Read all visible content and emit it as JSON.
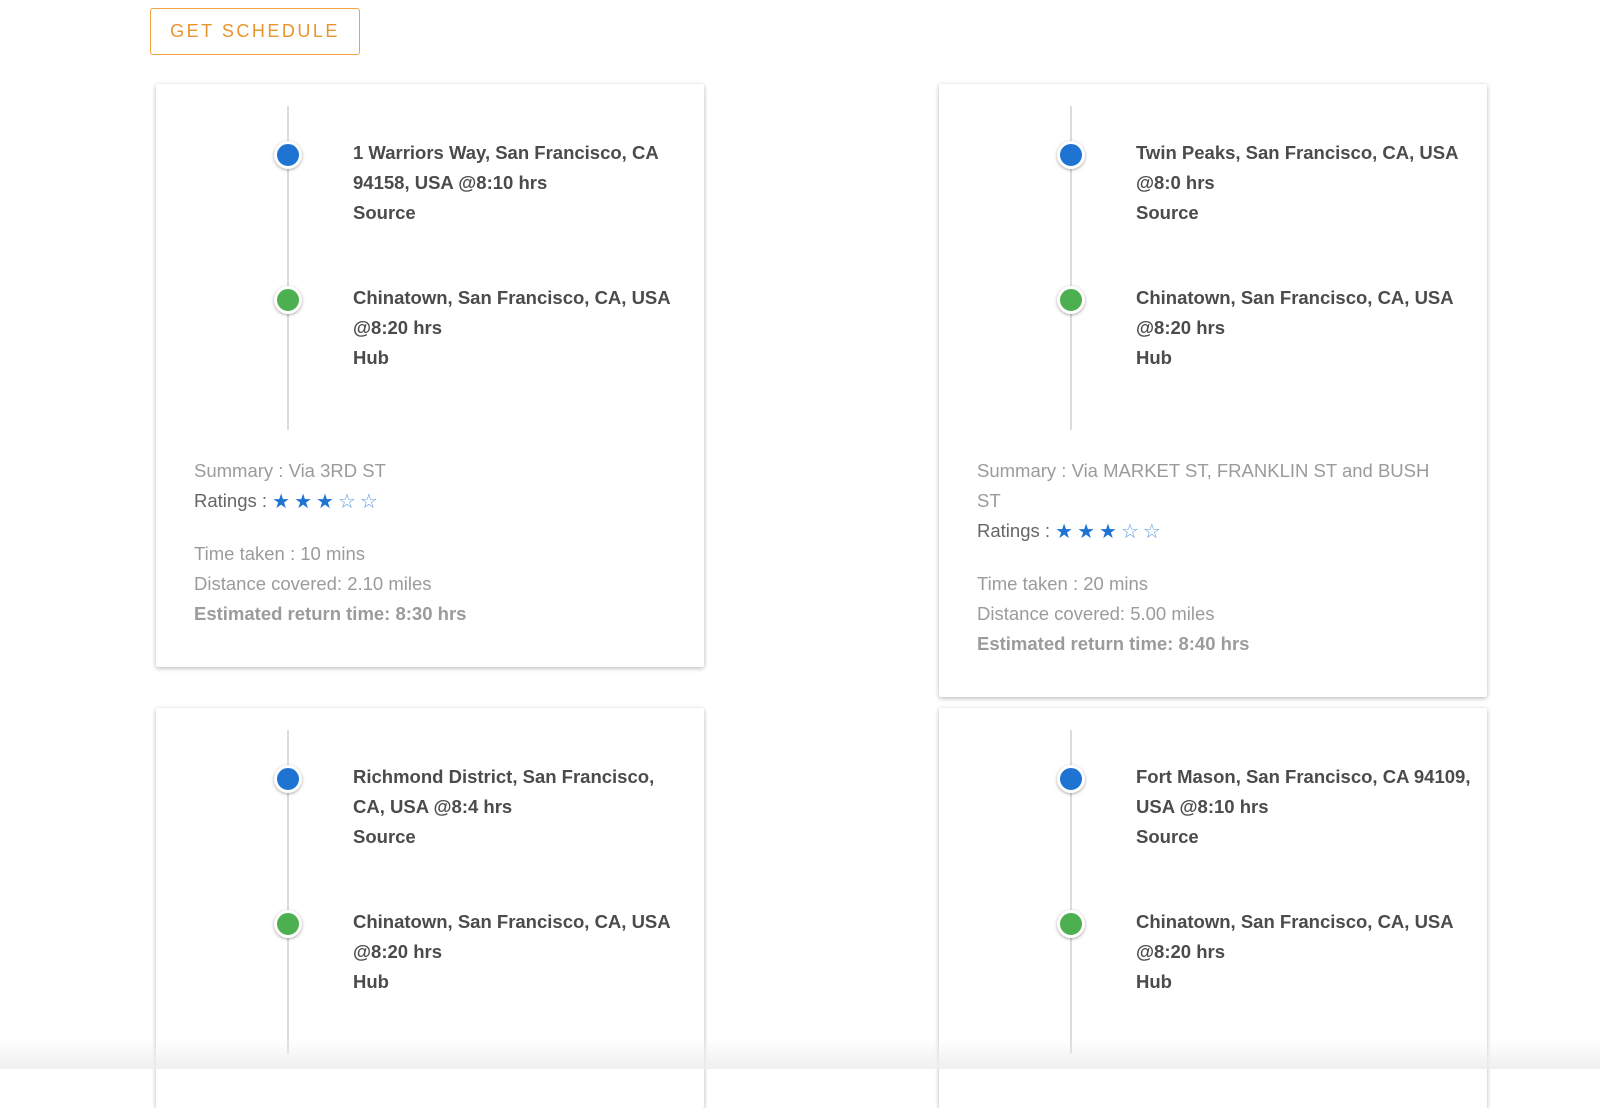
{
  "header": {
    "get_schedule_label": "GET SCHEDULE"
  },
  "colors": {
    "accent": "#f0a440",
    "source_dot": "#1e73d3",
    "hub_dot": "#4caf50",
    "star": "#1e73d3"
  },
  "cards": [
    {
      "source": {
        "place": "1 Warriors Way, San Francisco, CA 94158, USA",
        "time": "@8:10 hrs",
        "role": "Source"
      },
      "hub": {
        "place": "Chinatown, San Francisco, CA, USA",
        "time": "@8:20 hrs",
        "role": "Hub"
      },
      "summary": "Summary : Via 3RD ST",
      "ratings_label": "Ratings :",
      "rating": 3,
      "rating_max": 5,
      "time_taken": "Time taken : 10 mins",
      "distance": "Distance covered: 2.10 miles",
      "return_time": "Estimated return time: 8:30 hrs"
    },
    {
      "source": {
        "place": "Twin Peaks, San Francisco, CA, USA",
        "time": "@8:0 hrs",
        "role": "Source"
      },
      "hub": {
        "place": "Chinatown, San Francisco, CA, USA",
        "time": "@8:20 hrs",
        "role": "Hub"
      },
      "summary": "Summary : Via MARKET ST, FRANKLIN ST and BUSH ST",
      "ratings_label": "Ratings :",
      "rating": 3,
      "rating_max": 5,
      "time_taken": "Time taken : 20 mins",
      "distance": "Distance covered: 5.00 miles",
      "return_time": "Estimated return time: 8:40 hrs"
    },
    {
      "source": {
        "place": "Richmond District, San Francisco, CA, USA",
        "time": "@8:4 hrs",
        "role": "Source"
      },
      "hub": {
        "place": "Chinatown, San Francisco, CA, USA",
        "time": "@8:20 hrs",
        "role": "Hub"
      }
    },
    {
      "source": {
        "place": "Fort Mason, San Francisco, CA 94109, USA",
        "time": "@8:10 hrs",
        "role": "Source"
      },
      "hub": {
        "place": "Chinatown, San Francisco, CA, USA",
        "time": "@8:20 hrs",
        "role": "Hub"
      }
    }
  ]
}
